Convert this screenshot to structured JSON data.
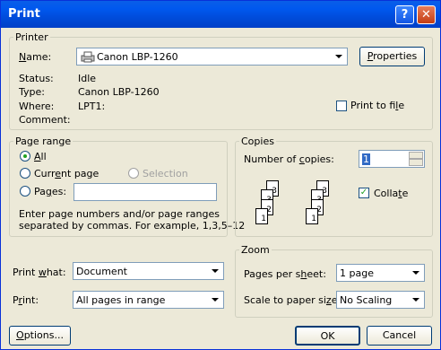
{
  "window": {
    "title": "Print",
    "help_glyph": "?",
    "close_glyph": "✕"
  },
  "printer": {
    "legend": "Printer",
    "name_label": "Name:",
    "name_value": "Canon LBP-1260",
    "properties_label": "Properties",
    "status_label": "Status:",
    "status_value": "Idle",
    "type_label": "Type:",
    "type_value": "Canon LBP-1260",
    "where_label": "Where:",
    "where_value": "LPT1:",
    "comment_label": "Comment:",
    "print_to_file_label": "Print to file"
  },
  "page_range": {
    "legend": "Page range",
    "all_label": "All",
    "current_page_label": "Current page",
    "selection_label": "Selection",
    "pages_label": "Pages:",
    "pages_value": "",
    "help_line1": "Enter page numbers and/or page ranges",
    "help_line2": "separated by commas.  For example, 1,3,5–12"
  },
  "copies": {
    "legend": "Copies",
    "number_label": "Number of copies:",
    "number_value": "1",
    "collate_label": "Collate",
    "collate_checked": true,
    "stack_digits": [
      "3",
      "2",
      "1"
    ]
  },
  "print_what": {
    "label": "Print what:",
    "value": "Document"
  },
  "print": {
    "label": "Print:",
    "value": "All pages in range"
  },
  "zoom": {
    "legend": "Zoom",
    "pages_per_sheet_label": "Pages per sheet:",
    "pages_per_sheet_value": "1 page",
    "scale_label": "Scale to paper size:",
    "scale_value": "No Scaling"
  },
  "buttons": {
    "options": "Options...",
    "ok": "OK",
    "cancel": "Cancel"
  }
}
